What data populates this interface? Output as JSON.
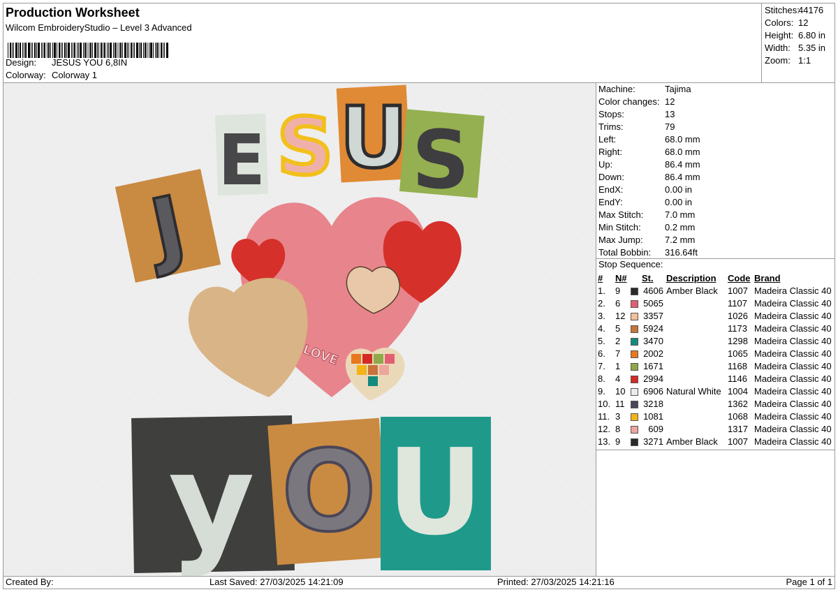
{
  "header": {
    "title": "Production Worksheet",
    "subtitle": "Wilcom EmbroideryStudio – Level 3 Advanced",
    "design_label": "Design:",
    "design_value": "JESUS YOU 6,8IN",
    "colorway_label": "Colorway:",
    "colorway_value": "Colorway 1"
  },
  "stats": [
    {
      "k": "Stitches:",
      "v": "44176"
    },
    {
      "k": "Colors:",
      "v": "12"
    },
    {
      "k": "Height:",
      "v": "6.80 in"
    },
    {
      "k": "Width:",
      "v": "5.35 in"
    },
    {
      "k": "Zoom:",
      "v": "1:1"
    }
  ],
  "machine": [
    {
      "k": "Machine:",
      "v": "Tajima"
    },
    {
      "k": "Color changes:",
      "v": "12"
    },
    {
      "k": "Stops:",
      "v": "13"
    },
    {
      "k": "Trims:",
      "v": "79"
    },
    {
      "k": "Left:",
      "v": "68.0 mm"
    },
    {
      "k": "Right:",
      "v": "68.0 mm"
    },
    {
      "k": "Up:",
      "v": "86.4 mm"
    },
    {
      "k": "Down:",
      "v": "86.4 mm"
    },
    {
      "k": "EndX:",
      "v": "0.00 in"
    },
    {
      "k": "EndY:",
      "v": "0.00 in"
    },
    {
      "k": "Max Stitch:",
      "v": "7.0 mm"
    },
    {
      "k": "Min Stitch:",
      "v": "0.2 mm"
    },
    {
      "k": "Max Jump:",
      "v": "7.2 mm"
    },
    {
      "k": "Total Bobbin:",
      "v": "316.64ft"
    }
  ],
  "stop_sequence": {
    "title": "Stop Sequence:",
    "headers": [
      "#",
      "N#",
      "St.",
      "Description",
      "Code",
      "Brand"
    ],
    "rows": [
      {
        "n": "1.",
        "nn": "9",
        "color": "#2a2a2a",
        "st": "4606",
        "desc": "Amber Black",
        "code": "1007",
        "brand": "Madeira Classic 40"
      },
      {
        "n": "2.",
        "nn": "6",
        "color": "#e25f73",
        "st": "5065",
        "desc": "",
        "code": "1107",
        "brand": "Madeira Classic 40"
      },
      {
        "n": "3.",
        "nn": "12",
        "color": "#f2c09a",
        "st": "3357",
        "desc": "",
        "code": "1026",
        "brand": "Madeira Classic 40"
      },
      {
        "n": "4.",
        "nn": "5",
        "color": "#c8733a",
        "st": "5924",
        "desc": "",
        "code": "1173",
        "brand": "Madeira Classic 40"
      },
      {
        "n": "5.",
        "nn": "2",
        "color": "#148a7c",
        "st": "3470",
        "desc": "",
        "code": "1298",
        "brand": "Madeira Classic 40"
      },
      {
        "n": "6.",
        "nn": "7",
        "color": "#e8781e",
        "st": "2002",
        "desc": "",
        "code": "1065",
        "brand": "Madeira Classic 40"
      },
      {
        "n": "7.",
        "nn": "1",
        "color": "#8fa84a",
        "st": "1671",
        "desc": "",
        "code": "1168",
        "brand": "Madeira Classic 40"
      },
      {
        "n": "8.",
        "nn": "4",
        "color": "#d42a24",
        "st": "2994",
        "desc": "",
        "code": "1146",
        "brand": "Madeira Classic 40"
      },
      {
        "n": "9.",
        "nn": "10",
        "color": "#ececea",
        "st": "6906",
        "desc": "Natural White",
        "code": "1004",
        "brand": "Madeira Classic 40"
      },
      {
        "n": "10.",
        "nn": "11",
        "color": "#4a4658",
        "st": "3218",
        "desc": "",
        "code": "1362",
        "brand": "Madeira Classic 40"
      },
      {
        "n": "11.",
        "nn": "3",
        "color": "#f3b418",
        "st": "1081",
        "desc": "",
        "code": "1068",
        "brand": "Madeira Classic 40"
      },
      {
        "n": "12.",
        "nn": "8",
        "color": "#eea59c",
        "st": "609",
        "desc": "",
        "code": "1317",
        "brand": "Madeira Classic 40"
      },
      {
        "n": "13.",
        "nn": "9",
        "color": "#2a2a2a",
        "st": "3271",
        "desc": "Amber Black",
        "code": "1007",
        "brand": "Madeira Classic 40"
      }
    ]
  },
  "preview": {
    "letters_top": [
      "J",
      "E",
      "S",
      "U",
      "S"
    ],
    "letters_bottom": [
      "y",
      "O",
      "U"
    ],
    "love_text": "LOVE"
  },
  "footer": {
    "created_by": "Created By:",
    "last_saved": "Last Saved: 27/03/2025 14:21:09",
    "printed": "Printed: 27/03/2025 14:21:16",
    "page": "Page 1 of 1"
  }
}
